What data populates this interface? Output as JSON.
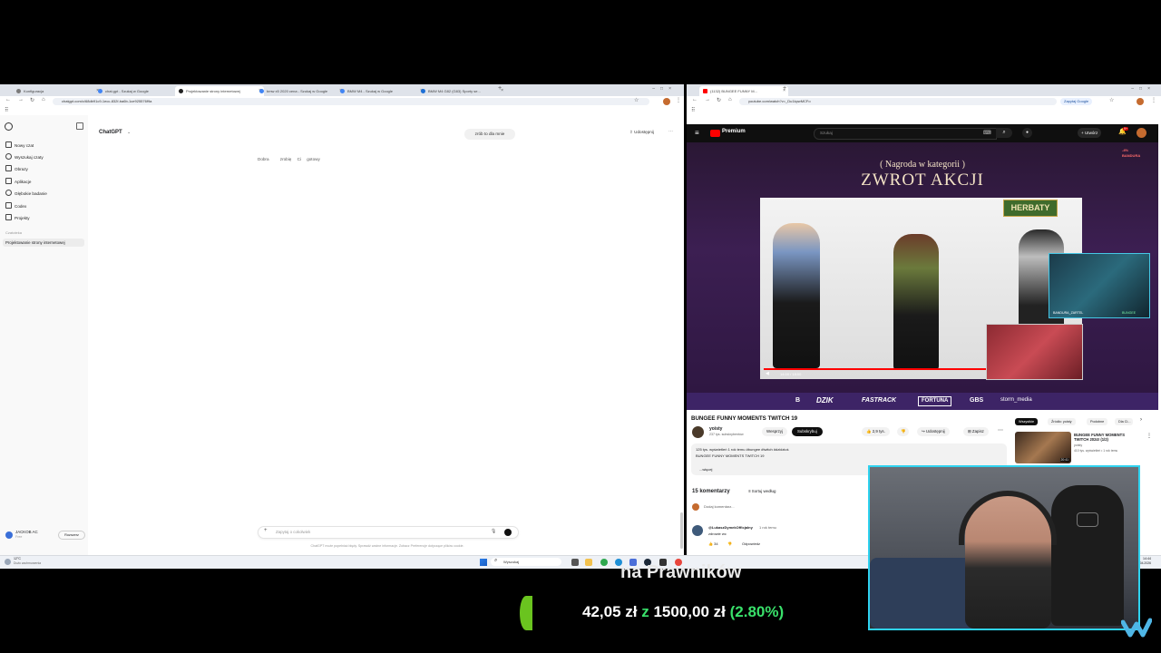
{
  "left_browser": {
    "tabs": [
      {
        "label": "Konfiguracja"
      },
      {
        "label": "chat.gpt - Szukaj w Google"
      },
      {
        "label": "Projektowanie strony internetowej"
      },
      {
        "label": "bmw x5 2020 cena - Szukaj w Google"
      },
      {
        "label": "BMW M4 - Szukaj w Google"
      },
      {
        "label": "BMW M4 G82 (G83) Sporty se..."
      }
    ],
    "url": "chatgpt.com/c/68db91c9-1ecc-832f-ba6b-1ce925576f9a",
    "app_title": "ChatGPT",
    "center_pill": "zrób to dla mnie",
    "share_label": "Udostępnij",
    "messages": [
      "Dobra",
      "zrobię Ci gotowy"
    ],
    "sidebar": {
      "items": [
        {
          "label": "Nowy czat"
        },
        {
          "label": "Wyszukaj czaty"
        },
        {
          "label": "Obrazy"
        },
        {
          "label": "Aplikacje"
        },
        {
          "label": "Głębokie badanie"
        },
        {
          "label": "Codex"
        },
        {
          "label": "Projekty"
        }
      ],
      "section_label": "Czatoteka",
      "active_chat": "Projektowanie strony internetowej",
      "user_name": "JACKOB AC",
      "user_plan": "Free",
      "upgrade_label": "Rozszerz"
    },
    "input_placeholder": "Zapytaj o cokolwiek",
    "disclaimer": "ChatGPT może popełniać błędy. Sprawdź ważne informacje. Zobacz Preferencje dotyczące plików cookie."
  },
  "taskbar": {
    "weather_temp": "12°C",
    "weather_desc": "Dużo zachmurzenia",
    "search_placeholder": "Wyszukaj",
    "time": "14:44",
    "date": "01.04.2026"
  },
  "right_browser": {
    "tab_label": "(1132) BUNGEE FUNNY M...",
    "url": "youtube.com/watch?v=_Du1kpwMCFo",
    "ask_google": "Zapytaj Google",
    "youtube": {
      "logo_label": "Premium",
      "search_placeholder": "Szukaj",
      "create_label": "Utwórz",
      "notif_count": "9+",
      "video_title_banner": "( Nagroda w kategorii )",
      "video_big_text": "ZWROT AKCJI",
      "herbaty_label": "HERBATY",
      "streamer_tag_1": "BANDURA_ZARTEL",
      "streamer_tag_2": "BUNGEE",
      "time_display": "14:00 / 18:00",
      "sponsors": [
        "B",
        "DZIK",
        "FASTRACK",
        "FORTUNA",
        "GBS",
        "storm_media"
      ],
      "bandura_label": "BANDURA",
      "bandura_percent": "-4%",
      "title": "BUNGEE FUNNY MOMENTS TWITCH 19",
      "channel_name": "yoisty",
      "subscribers": "237 tys. subskrybentów",
      "support_label": "Wesprzyj",
      "subscribe_label": "Subskrybuj",
      "likes": "2,9 tys.",
      "share_label": "Udostępnij",
      "save_label": "Zapisz",
      "stats_line": "125 tys. wyświetleń  1 rok temu  #bungee #twitch #dzidziuś",
      "description": "BUNGEE FUNNY MOMENTS TWITCH 19",
      "more_label": "...więcej",
      "comments_count": "15 komentarzy",
      "sort_label": "Sortuj według",
      "add_comment": "Dodaj komentarz...",
      "comment_author": "@LukaszDymekOfficjalny",
      "comment_time": "1 rok temu",
      "comment_text": "zdrowie wc",
      "comment_likes": "34",
      "reply_label": "Odpowiedz",
      "chips": [
        "Wszystkie",
        "Źródło: yoisty",
        "Podobne",
        "Dla Ci..."
      ],
      "rec_title": "BUNGEE FUNNY MOMENTS TWITCH 2024! (1/2)",
      "rec_channel": "yoisty",
      "rec_meta": "410 tys. wyświetleń • 1 rok temu",
      "rec_duration": "20:41"
    }
  },
  "overlay": {
    "banner_text": "na Prawników",
    "goal_current": "42,05 zł",
    "goal_separator": "z",
    "goal_target": "1500,00 zł",
    "goal_percent": "(2.80%)",
    "goal_progress": 0.028
  },
  "colors": {
    "stream_green": "#39e06a",
    "goal_green_bar": "#6ac41f",
    "cam_border": "#2fd3f0",
    "youtube_red": "#ff0000"
  }
}
